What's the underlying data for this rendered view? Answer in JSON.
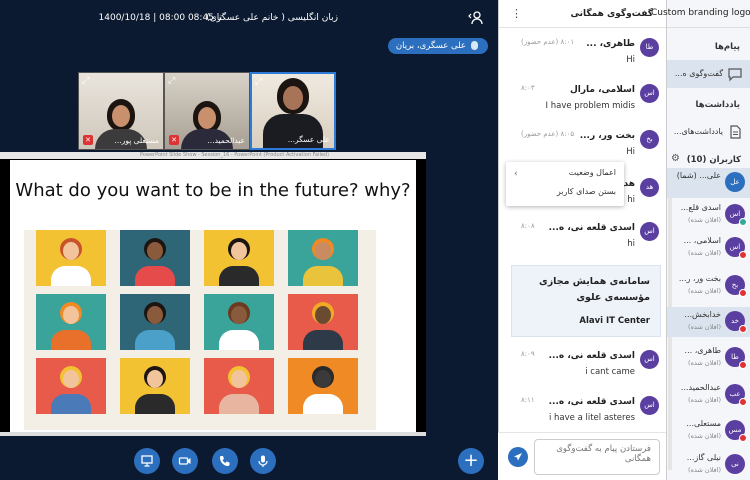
{
  "topbar": {
    "session_title": "زبان انگلیسی ( خانم علی عسگری)",
    "session_date": "1400/10/18 | 08:00 تا 08:45",
    "presenter": "علی عسگری، بریان"
  },
  "videos": [
    {
      "name": "علی عسگر..."
    },
    {
      "name": "عبدالحمید..."
    },
    {
      "name": "مستعلی پور..."
    }
  ],
  "slide": {
    "toolbar_text": "PowerPoint Slide Show - Session_16 - PowerPoint (Product Activation Failed)",
    "heading": "What do you want to be in the future? why?"
  },
  "chat": {
    "title": "گفت‌وگوی همگانی",
    "messages": [
      {
        "avatar": "طا",
        "sender": "طاهری، ...",
        "meta": "۸:۰۱ (عدم حضور)",
        "text": "Hi"
      },
      {
        "avatar": "اس",
        "sender": "اسلامی، مارال",
        "meta": "۸:۰۳",
        "text": "I have problem midis"
      },
      {
        "avatar": "بخ",
        "sender": "بخت ور، ر...",
        "meta": "۸:۰۵ (عدم حضور)",
        "text": "Hi"
      },
      {
        "avatar": "هد",
        "sender": "هد...",
        "meta": "",
        "text": "hi"
      },
      {
        "avatar": "اس",
        "sender": "اسدی قلعه نی، ه...",
        "meta": "۸:۰۸",
        "text": "hi"
      },
      {
        "avatar": "اس",
        "sender": "اسدی قلعه نی، ه...",
        "meta": "۸:۰۹",
        "text": "i cant came"
      },
      {
        "avatar": "اس",
        "sender": "اسدی قلعه نی، ه...",
        "meta": "۸:۱۱",
        "text": "i have a litel asteres"
      }
    ],
    "context_menu": {
      "item1": "اعمال وضعیت",
      "item2": "بستن صدای کاربر"
    },
    "branding_card": {
      "line1": "سامانه‌ی همایش مجازی",
      "line2": "مؤسسه‌ی علوی",
      "line3": "Alavi IT Center"
    },
    "input_placeholder": "فرستادن پیام به گفت‌وگوی همگانی"
  },
  "sidebar": {
    "logo_text": "Custom branding logo",
    "messages_section": "پیام‌ها",
    "public_chat": "گفت‌وگوی ه...",
    "notes_section": "یادداشت‌ها",
    "shared_notes": "یادداشت‌های...",
    "users_header": "کاربران (10)",
    "users": [
      {
        "avatar": "عل",
        "name": "علی... (شما)",
        "status": "",
        "color": "#2d6fbf"
      },
      {
        "avatar": "اس",
        "name": "اسدی قلع...",
        "status": "(افلان شده)",
        "color": "#5b3fa0"
      },
      {
        "avatar": "اس",
        "name": "اسلامی، ...",
        "status": "(افلان شده)",
        "color": "#5b3fa0"
      },
      {
        "avatar": "بخ",
        "name": "بخت ور، ر...",
        "status": "(افلان شده)",
        "color": "#5b3fa0"
      },
      {
        "avatar": "خد",
        "name": "خدابخش...",
        "status": "(افلان شده)",
        "color": "#5b3fa0"
      },
      {
        "avatar": "طا",
        "name": "طاهری، ...",
        "status": "(افلان شده)",
        "color": "#5b3fa0"
      },
      {
        "avatar": "عب",
        "name": "عبدالحمید...",
        "status": "(افلان شده)",
        "color": "#5b3fa0"
      },
      {
        "avatar": "مس",
        "name": "مستعلی...",
        "status": "(افلان شده)",
        "color": "#5b3fa0"
      },
      {
        "avatar": "نی",
        "name": "نیلی گاز...",
        "status": "(افلان شده)",
        "color": "#5b3fa0"
      }
    ]
  }
}
